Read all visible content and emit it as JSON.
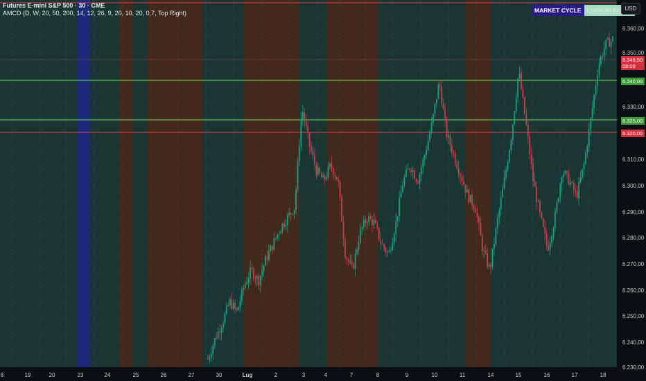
{
  "header": {
    "symbol_line": "Futures E-mini S&P 500 · 30 · CME",
    "indicator_line": "AMCD (D, W, 20, 50, 200, 14, 12, 26, 9, 20, 10, 20, 0,7, Top Right)"
  },
  "currency_button": "USD",
  "badges": {
    "cycle_label": "MARKET CYCLE",
    "state_label": "LOCK IN ASSET"
  },
  "price_axis": {
    "labels": [
      "6.360,00",
      "6.350,00",
      "6.330,00",
      "6.310,00",
      "6.300,00",
      "6.290,00",
      "6.280,00",
      "6.270,00",
      "6.260,00",
      "6.250,00",
      "6.240,00",
      "6.230,00"
    ]
  },
  "price_tags": {
    "last_price": "6.348,50",
    "countdown": "09:09",
    "level_1": "6.340,00",
    "level_2": "6.325,00",
    "level_3": "6.320,00"
  },
  "date_axis": {
    "labels": [
      "8",
      "19",
      "20",
      "23",
      "24",
      "25",
      "26",
      "27",
      "30",
      "Lug",
      "2",
      "3",
      "4",
      "7",
      "8",
      "9",
      "10",
      "11",
      "14",
      "15",
      "16",
      "17",
      "18"
    ]
  },
  "colors": {
    "background": "#10211f",
    "bull_band": "#1b3a36",
    "bear_band": "#4a2a1c",
    "blue_band": "#1d2a8a",
    "resistance": "#e0404a",
    "support": "#7ed957",
    "candle_up": "#1f9e82",
    "candle_down": "#c8404a"
  },
  "chart_data": {
    "type": "candlestick",
    "y_range": [
      6225,
      6365
    ],
    "price_series": [
      6228,
      6236,
      6242,
      6250,
      6246,
      6256,
      6262,
      6258,
      6266,
      6272,
      6278,
      6282,
      6286,
      6324,
      6310,
      6300,
      6296,
      6302,
      6296,
      6268,
      6262,
      6276,
      6282,
      6280,
      6272,
      6268,
      6280,
      6296,
      6302,
      6296,
      6306,
      6318,
      6334,
      6314,
      6306,
      6298,
      6290,
      6286,
      6270,
      6262,
      6280,
      6296,
      6314,
      6338,
      6318,
      6296,
      6282,
      6270,
      6282,
      6300,
      6296,
      6290,
      6302,
      6320,
      6340,
      6348,
      6350
    ]
  }
}
